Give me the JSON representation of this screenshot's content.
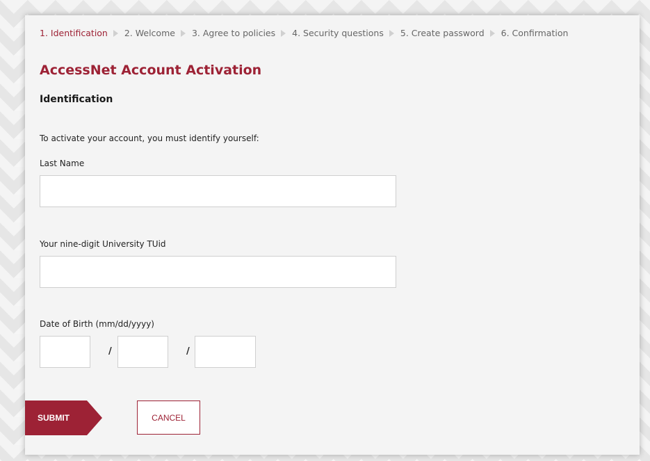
{
  "steps": [
    {
      "label": "1. Identification",
      "active": true
    },
    {
      "label": "2. Welcome",
      "active": false
    },
    {
      "label": "3. Agree to policies",
      "active": false
    },
    {
      "label": "4. Security questions",
      "active": false
    },
    {
      "label": "5. Create password",
      "active": false
    },
    {
      "label": "6. Confirmation",
      "active": false
    }
  ],
  "page": {
    "title": "AccessNet Account Activation",
    "subtitle": "Identification",
    "intro": "To activate your account, you must identify yourself:"
  },
  "form": {
    "last_name_label": "Last Name",
    "last_name_value": "",
    "tuid_label": "Your nine-digit University TUid",
    "tuid_value": "",
    "dob_label": "Date of Birth (mm/dd/yyyy)",
    "dob_separator": "/",
    "dob_month": "",
    "dob_day": "",
    "dob_year": ""
  },
  "buttons": {
    "submit": "SUBMIT",
    "cancel": "CANCEL"
  },
  "colors": {
    "accent": "#9d2235",
    "card_bg": "#f4f4f4"
  },
  "icons": {
    "step_separator": "chevron-right-icon"
  }
}
